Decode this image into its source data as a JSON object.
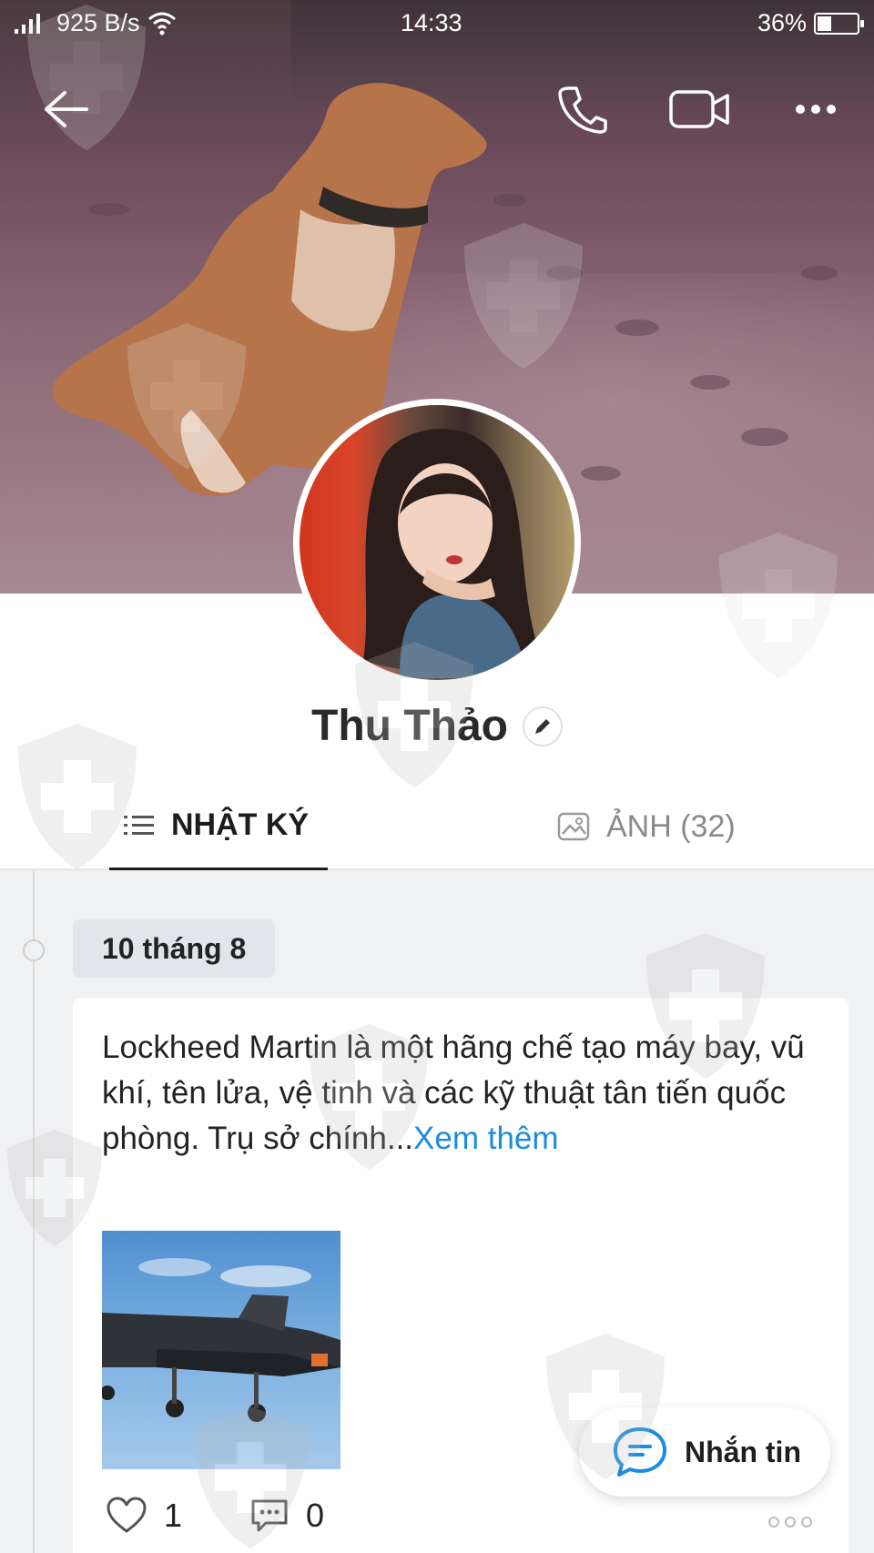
{
  "status_bar": {
    "network_speed": "925 B/s",
    "time": "14:33",
    "battery_percent": "36%",
    "battery_level": 0.36
  },
  "top_actions": {
    "back_icon": "back-arrow-icon",
    "call_icon": "phone-icon",
    "video_icon": "video-camera-icon",
    "more_icon": "more-horizontal-icon"
  },
  "profile": {
    "name": "Thu Thảo"
  },
  "tabs": [
    {
      "label": "NHẬT KÝ",
      "icon": "list-icon",
      "active": true
    },
    {
      "label": "ẢNH (32)",
      "icon": "image-icon",
      "active": false
    }
  ],
  "timeline": {
    "date": "10 tháng 8"
  },
  "post": {
    "text": "Lockheed Martin là một hãng chế tạo máy bay, vũ khí, tên lửa, vệ tinh và các kỹ thuật tân tiến quốc phòng. Trụ sở chính...",
    "more_label": "Xem thêm",
    "likes": "1",
    "comments": "0"
  },
  "message_button": {
    "label": "Nhắn tin"
  },
  "colors": {
    "link": "#1b8ce0",
    "message_icon": "#1b8ce0"
  }
}
